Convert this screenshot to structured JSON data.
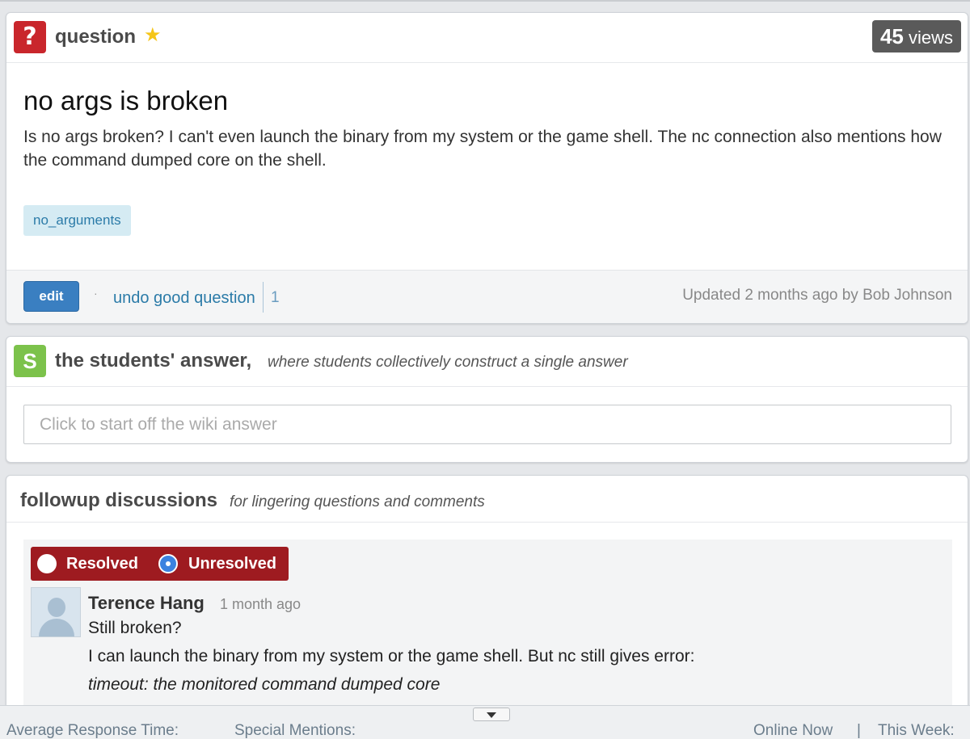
{
  "question": {
    "label": "question",
    "views_count": "45",
    "views_label": "views",
    "title": "no args is broken",
    "body": "Is no args broken?  I can't even launch the binary from my system or the game shell.  The nc connection also mentions how the command dumped core on the shell.",
    "tag": "no_arguments",
    "edit_label": "edit",
    "good_question_link": "undo good question",
    "good_question_count": "1",
    "updated_text": "Updated 2 months ago by Bob Johnson"
  },
  "students_answer": {
    "icon_letter": "S",
    "title": "the students' answer,",
    "subtitle": "where students collectively construct a single answer",
    "placeholder": "Click to start off the wiki answer"
  },
  "followup": {
    "title": "followup discussions",
    "subtitle": "for lingering questions and comments",
    "resolved_label": "Resolved",
    "unresolved_label": "Unresolved",
    "selected": "Unresolved",
    "post": {
      "author": "Terence Hang",
      "time": "1 month ago",
      "lines": [
        "Still broken?",
        "I can launch the binary from my system or the game shell.  But nc still gives error:",
        "timeout: the monitored command dumped core"
      ]
    }
  },
  "bottom_bar": {
    "avg_response": "Average Response Time:",
    "special_mentions": "Special Mentions:",
    "online_now": "Online Now",
    "separator": "|",
    "this_week": "This Week:"
  },
  "colors": {
    "question_icon": "#c9262c",
    "students_icon": "#7cc24b",
    "resolve_bar": "#9e1b20",
    "link": "#2b7ba8",
    "edit_button": "#3a7fc1"
  },
  "icons": [
    "question-mark-icon",
    "star-icon",
    "students-s-icon",
    "radio-icon",
    "default-avatar-icon",
    "chevron-down-icon"
  ]
}
